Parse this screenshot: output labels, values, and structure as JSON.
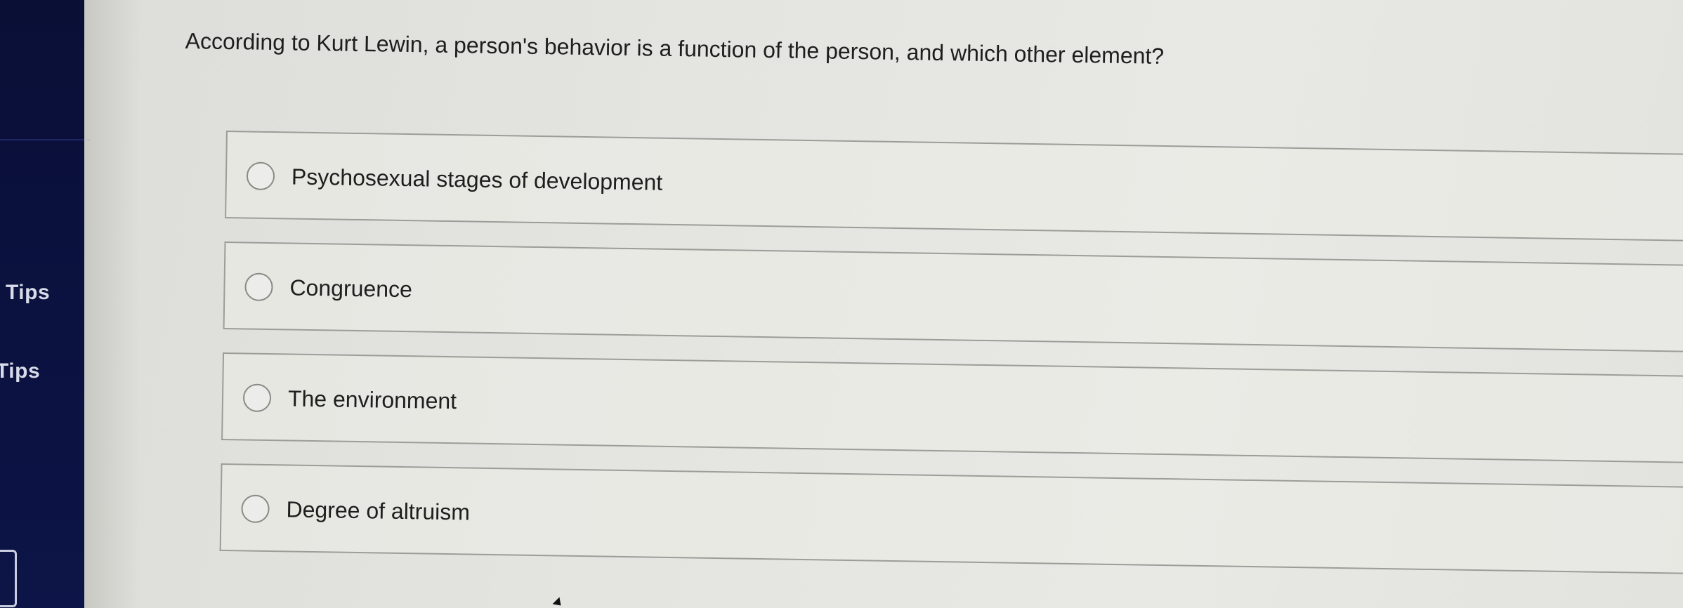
{
  "sidebar": {
    "tips": [
      "Tips",
      "Tips"
    ]
  },
  "question": {
    "text": "According to Kurt Lewin, a person's behavior is a function of the person, and which other element?"
  },
  "choices": [
    {
      "label": "Psychosexual stages of development",
      "selected": false
    },
    {
      "label": "Congruence",
      "selected": false
    },
    {
      "label": "The environment",
      "selected": false
    },
    {
      "label": "Degree of altruism",
      "selected": false
    }
  ],
  "colors": {
    "sidebar": "#0b1240",
    "background": "#e4e4e0",
    "text": "#1e1e1e",
    "border": "#9c9c98"
  }
}
